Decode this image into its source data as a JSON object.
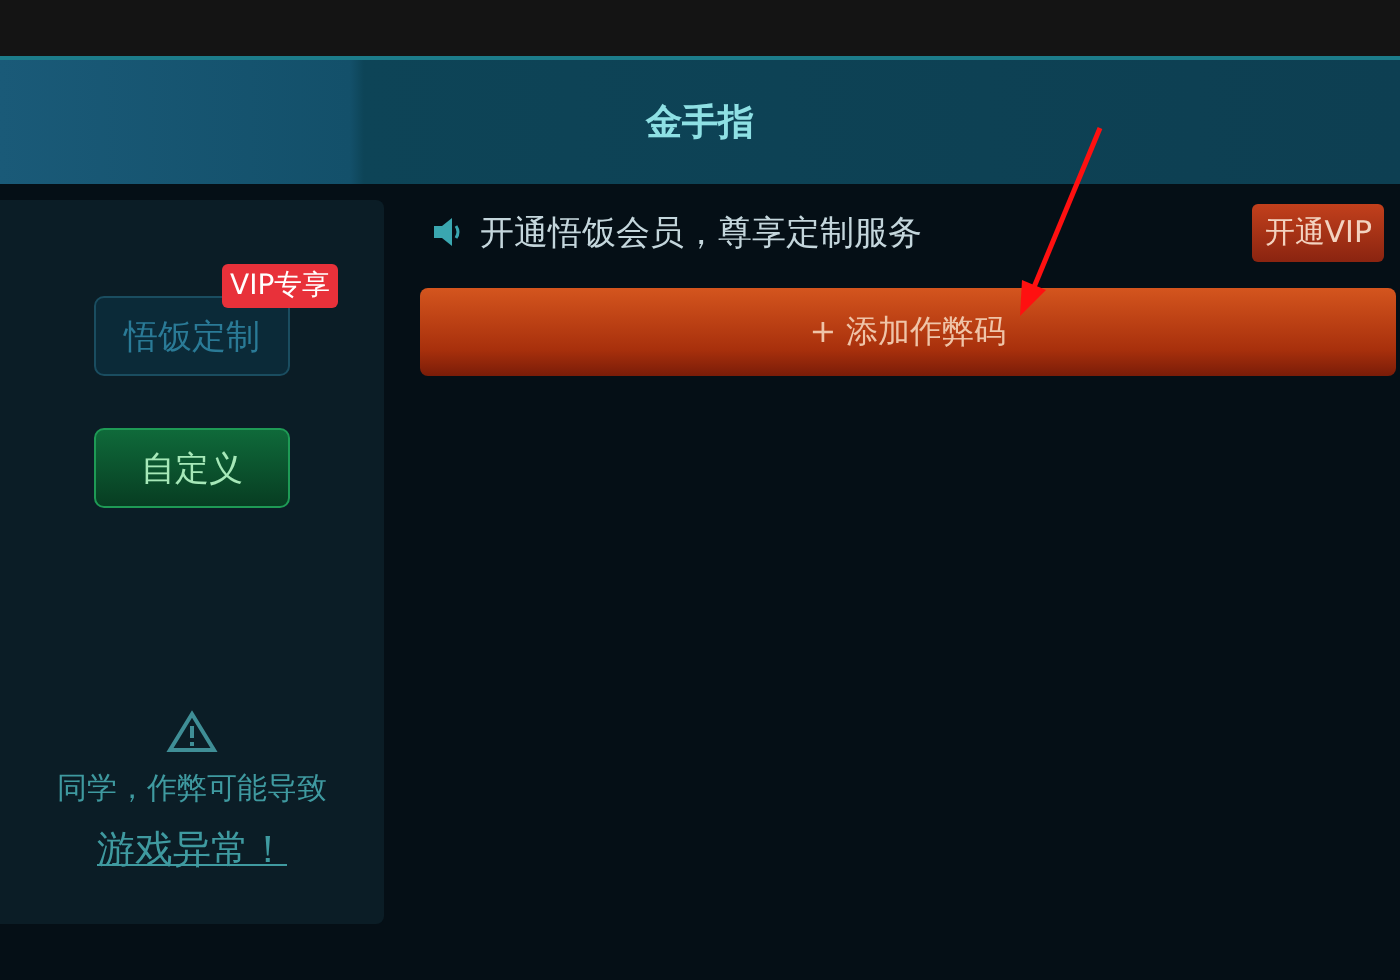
{
  "window": {
    "title": "金手指"
  },
  "sidebar": {
    "tabs": [
      {
        "label": "悟饭定制",
        "selected": false,
        "badge": "VIP专享"
      },
      {
        "label": "自定义",
        "selected": true
      }
    ],
    "warning": {
      "line_1": "同学，作弊可能导致",
      "link": "游戏异常！"
    }
  },
  "notice": {
    "text": "开通悟饭会员，尊享定制服务",
    "button": "开通VIP"
  },
  "add_button": "+ 添加作弊码"
}
